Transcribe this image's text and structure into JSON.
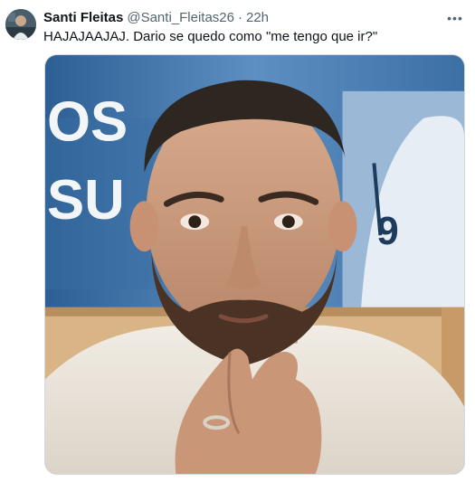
{
  "tweet": {
    "display_name": "Santi Fleitas",
    "handle": "@Santi_Fleitas26",
    "separator": "·",
    "time": "22h",
    "text": "HAJAJAAJAJ. Dario se quedo como \"me tengo que ir?\"",
    "more_icon": "more-horizontal-icon"
  },
  "media": {
    "backdrop_letters_line1": "OS",
    "backdrop_letters_line2": "SU",
    "jersey_number": "9"
  }
}
